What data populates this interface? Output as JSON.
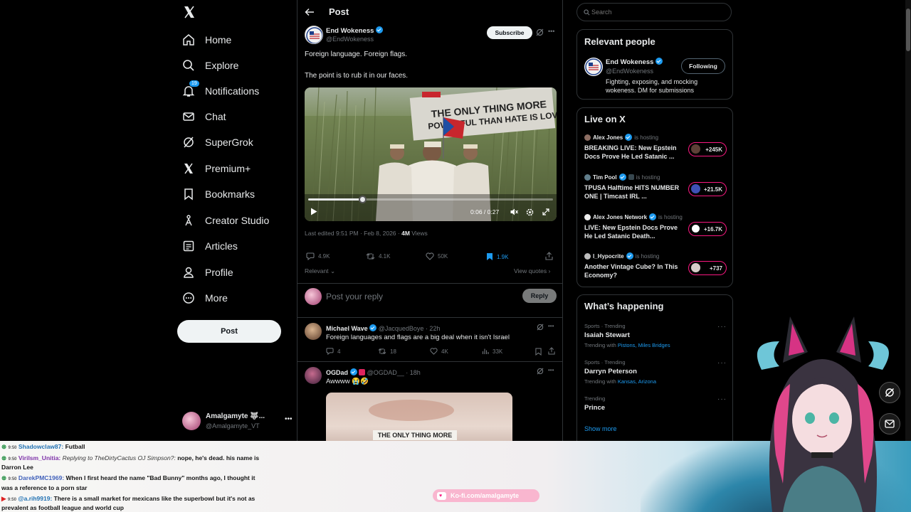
{
  "nav": {
    "items": [
      {
        "label": "Home"
      },
      {
        "label": "Explore"
      },
      {
        "label": "Notifications",
        "badge": "19"
      },
      {
        "label": "Chat"
      },
      {
        "label": "SuperGrok"
      },
      {
        "label": "Premium+"
      },
      {
        "label": "Bookmarks"
      },
      {
        "label": "Creator Studio"
      },
      {
        "label": "Articles"
      },
      {
        "label": "Profile"
      },
      {
        "label": "More"
      }
    ],
    "post_label": "Post",
    "account": {
      "name": "Amalgamyte 🐺...",
      "handle": "@Amalgamyte_VT"
    }
  },
  "header": {
    "title": "Post"
  },
  "post": {
    "author": "End Wokeness",
    "handle": "@EndWokeness",
    "subscribe_label": "Subscribe",
    "text_line1": "Foreign language. Foreign flags.",
    "text_line2": "The point is to rub it in our faces.",
    "video": {
      "time": "0:06 / 0:27",
      "sign_text": "THE ONLY THING MORE POWERFUL THAN HATE IS LOVE",
      "progress": 0.22
    },
    "meta_edited": "Last edited 9:51 PM · Feb 8, 2026 · ",
    "meta_views": "4M",
    "meta_views_label": " Views",
    "stats": {
      "replies": "4.9K",
      "reposts": "4.1K",
      "likes": "50K",
      "bookmarks": "1.9K"
    },
    "relevant_label": "Relevant",
    "view_quotes_label": "View quotes",
    "reply_placeholder": "Post your reply",
    "reply_button": "Reply"
  },
  "replies": [
    {
      "author": "Michael Wave",
      "handle": "@JacquedBoye",
      "time": "· 22h",
      "text": "Foreign languages and flags are a big deal when it isn't Israel",
      "stats": {
        "replies": "4",
        "reposts": "18",
        "likes": "4K",
        "views": "33K"
      }
    },
    {
      "author": "OGDad",
      "handle": "@OGDAD__",
      "time": "· 18h",
      "text": "Awwww 😭🤣",
      "image_text": "THE ONLY THING MORE"
    }
  ],
  "search": {
    "placeholder": "Search"
  },
  "relevant_people": {
    "title": "Relevant people",
    "name": "End Wokeness",
    "handle": "@EndWokeness",
    "follow_label": "Following",
    "bio": "Fighting, exposing, and mocking wokeness. DM for submissions"
  },
  "live": {
    "title": "Live on X",
    "hosting_label": "is hosting",
    "items": [
      {
        "host": "Alex Jones",
        "title": "BREAKING LIVE: New Epstein Docs Prove He Led Satanic ...",
        "count": "+245K"
      },
      {
        "host": "Tim Pool",
        "title": "TPUSA Halftime HITS NUMBER ONE | Timcast IRL ...",
        "count": "+21.5K"
      },
      {
        "host": "Alex Jones Network",
        "title": "LIVE: New Epstein Docs Prove He Led Satanic Death...",
        "count": "+16.7K"
      },
      {
        "host": "I_Hypocrite",
        "title": "Another Vintage Cube? In This Economy?",
        "count": "+737"
      }
    ]
  },
  "happening": {
    "title": "What’s happening",
    "trends": [
      {
        "category": "Sports · Trending",
        "name": "Isaiah Stewart",
        "with_label": "Trending with ",
        "with": "Pistons, Miles Bridges"
      },
      {
        "category": "Sports · Trending",
        "name": "Darryn Peterson",
        "with_label": "Trending with ",
        "with": "Kansas, Arizona"
      },
      {
        "category": "Trending",
        "name": "Prince",
        "with_label": "",
        "with": ""
      }
    ],
    "show_more": "Show more"
  },
  "stream_chat": [
    {
      "time": "9:50",
      "user": "Shadowclaw87:",
      "reply": "",
      "msg": "Futball"
    },
    {
      "time": "9:50",
      "user": "Virilsm_Unitia:",
      "reply": "Replying to TheDirtyCactus OJ Simpson?:",
      "msg": "nope, he's dead. his name is"
    },
    {
      "time": "",
      "user": "",
      "reply": "",
      "msg": "Darron Lee"
    },
    {
      "time": "9:50",
      "user": "DarekPMC1969:",
      "reply": "",
      "msg": "When I first heard the name \"Bad Bunny\" months ago, I thought it"
    },
    {
      "time": "",
      "user": "",
      "reply": "",
      "msg": "was a reference to a porn star"
    },
    {
      "time": "9:50",
      "user": "@a.rih9919:",
      "reply": "",
      "msg": "There is a small market for mexicans like the superbowl but it's not as"
    },
    {
      "time": "",
      "user": "",
      "reply": "",
      "msg": "prevalent as football league and world cup"
    }
  ],
  "kofi": {
    "label": "Ko-fi.com/amalgamyte"
  }
}
